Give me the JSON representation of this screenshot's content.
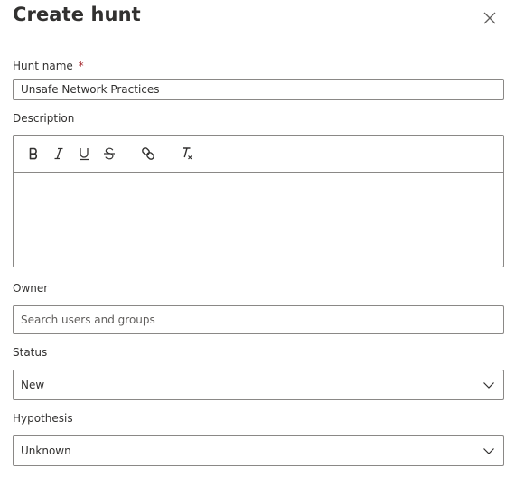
{
  "panel": {
    "title": "Create hunt"
  },
  "form": {
    "hunt_name": {
      "label": "Hunt name",
      "required_mark": "*",
      "value": "Unsafe Network Practices"
    },
    "description": {
      "label": "Description",
      "toolbar": [
        "bold-icon",
        "italic-icon",
        "underline-icon",
        "strikethrough-icon",
        "link-icon",
        "clear-formatting-icon"
      ]
    },
    "owner": {
      "label": "Owner",
      "placeholder": "Search users and groups"
    },
    "status": {
      "label": "Status",
      "selected": "New"
    },
    "hypothesis": {
      "label": "Hypothesis",
      "selected": "Unknown"
    }
  },
  "colors": {
    "text": "#323130",
    "border": "#8a8886",
    "placeholder": "#605e5c",
    "required": "#a4262c"
  }
}
